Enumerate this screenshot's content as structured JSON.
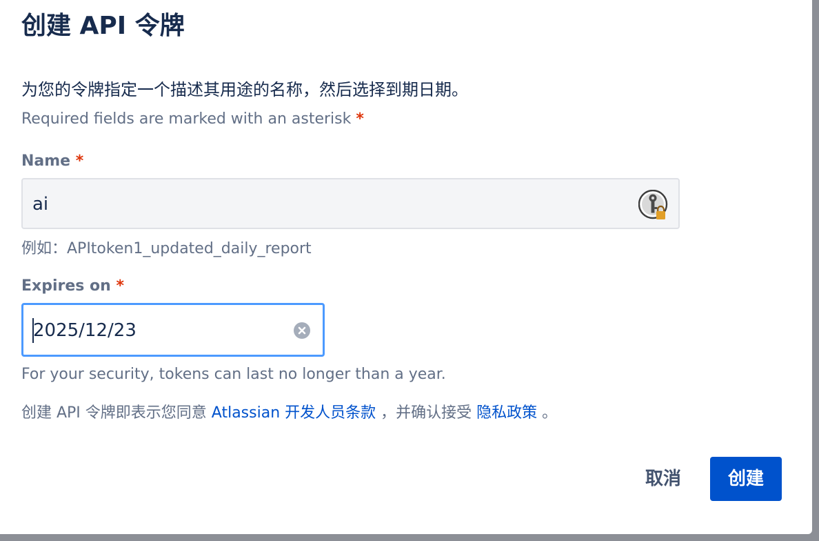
{
  "dialog": {
    "title": "创建 API 令牌",
    "description": "为您的令牌指定一个描述其用途的名称，然后选择到期日期。",
    "required_note": "Required fields are marked with an asterisk",
    "required_marker": "*"
  },
  "name_field": {
    "label": "Name",
    "value": "ai",
    "helper": "例如：APItoken1_updated_daily_report",
    "icon": "password-manager-key-lock-icon"
  },
  "expires_field": {
    "label": "Expires on",
    "value": "2025/12/23",
    "helper": "For your security, tokens can last no longer than a year.",
    "icon": "clear-icon"
  },
  "terms": {
    "prefix": "创建 API 令牌即表示您同意 ",
    "developer_terms_link": "Atlassian 开发人员条款",
    "middle": "，并确认接受",
    "privacy_link": "隐私政策",
    "suffix": "。"
  },
  "actions": {
    "cancel_label": "取消",
    "create_label": "创建"
  },
  "colors": {
    "primary": "#0052cc",
    "required": "#de350b",
    "focus_border": "#4c9aff",
    "text": "#172b4d",
    "subtle_text": "#626f86"
  }
}
